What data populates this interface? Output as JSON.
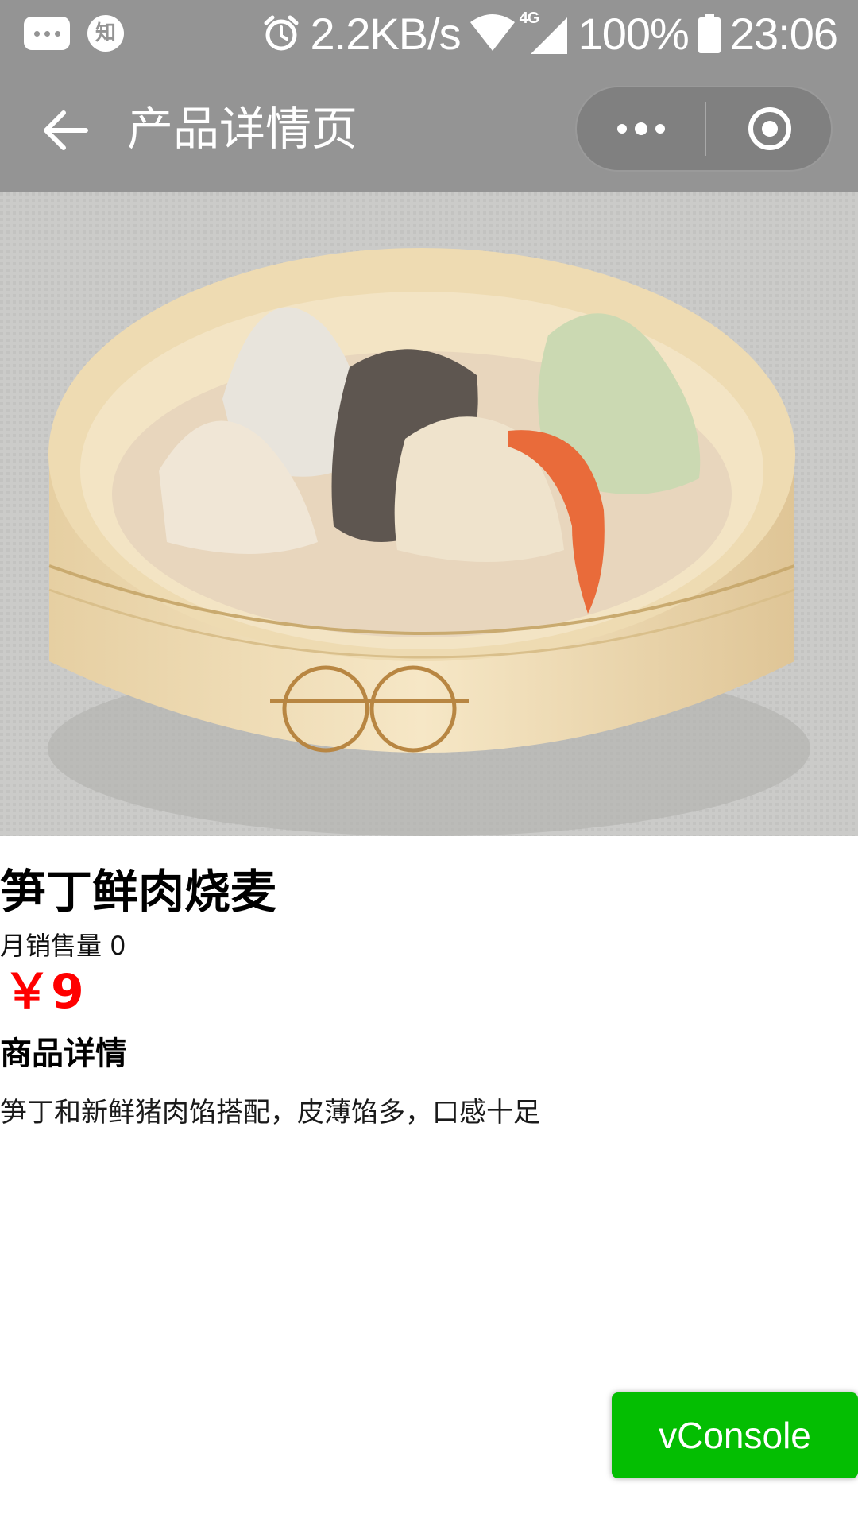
{
  "status_bar": {
    "speed": "2.2KB/s",
    "network": "4G",
    "battery": "100%",
    "time": "23:06",
    "left_icons": [
      "message-icon",
      "zhihu-icon"
    ],
    "zhihu_glyph": "知",
    "right_icons": [
      "alarm-icon",
      "wifi-icon",
      "signal-icon",
      "battery-icon"
    ]
  },
  "nav_bar": {
    "title": "产品详情页",
    "back_icon": "arrow-left-icon",
    "more_icon": "more-dots-icon",
    "close_icon": "target-circle-icon"
  },
  "product": {
    "image_alt": "steamer-dumplings-photo",
    "name": "笋丁鲜肉烧麦",
    "monthly_sales_text": "月销售量 0",
    "price_text": "￥9",
    "details_title": "商品详情",
    "description": "笋丁和新鲜猪肉馅搭配，皮薄馅多，口感十足"
  },
  "vconsole": {
    "label": "vConsole"
  },
  "colors": {
    "bar_bg": "#949494",
    "price": "#ff0000",
    "vconsole_bg": "#04be02"
  }
}
